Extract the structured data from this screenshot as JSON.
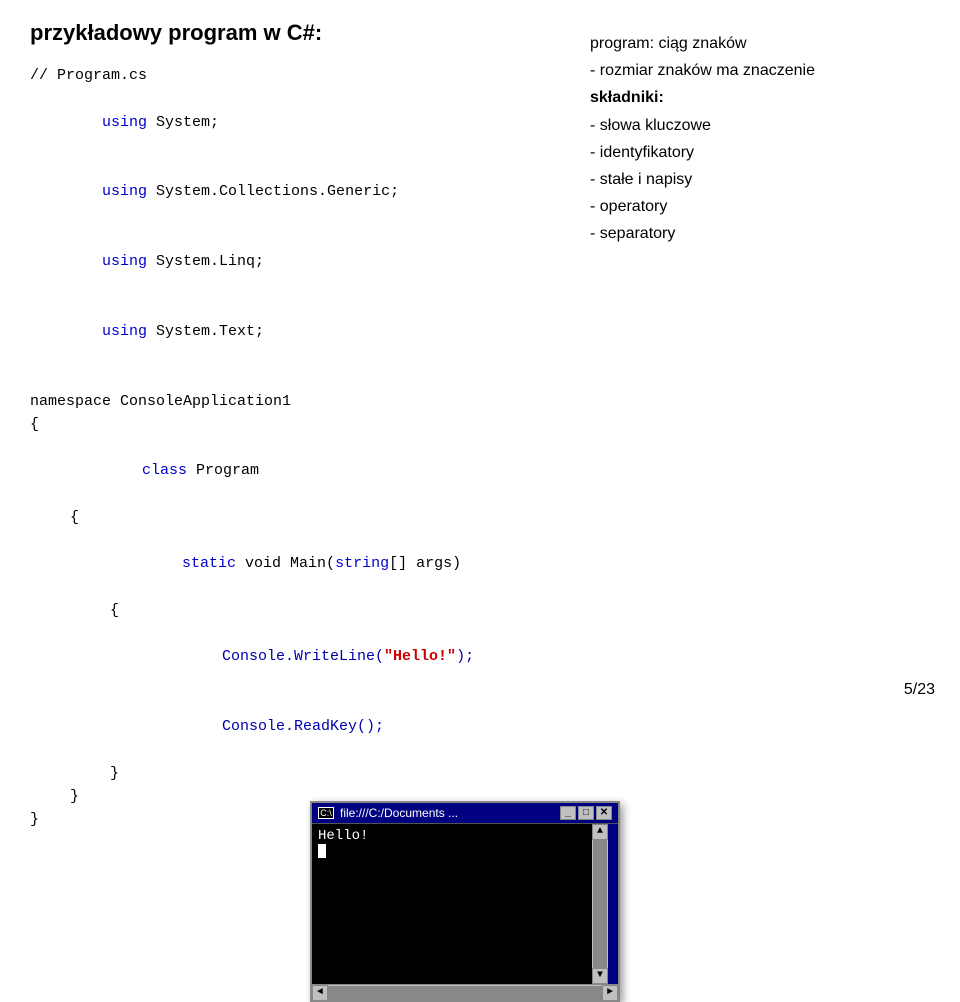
{
  "slide": {
    "title": "przykładowy program w C#:",
    "page_number": "5/23"
  },
  "code": {
    "comment_line": "// Program.cs",
    "using1": "using",
    "system1": " System;",
    "using2": "using",
    "system2": " System.Collections.Generic;",
    "using3": "using",
    "system3": " System.Linq;",
    "using4": "using",
    "system4": " System.Text;",
    "namespace_line": "namespace ConsoleApplication1",
    "brace_open1": "{",
    "class_line": "    class Program",
    "brace_open2": "    {",
    "static_line": "        static void Main(string[] args)",
    "brace_open3": "        {",
    "console_write": "            Console.",
    "writeline": "WriteLine(",
    "hello_str": "\"Hello!\"",
    "close_paren": ");",
    "console_read": "            Console.",
    "readkey": "ReadKey();",
    "brace_close1": "        }",
    "brace_close2": "    }",
    "brace_close3": "}"
  },
  "console_window": {
    "title": "file:///C:/Documents ...",
    "content_line1": "Hello!",
    "content_cursor": "_"
  },
  "description": {
    "line1": "program: ciąg znaków",
    "line2": "- rozmiar znaków ma znaczenie",
    "line3": "składniki:",
    "line4": "- słowa kluczowe",
    "line5": "- identyfikatory",
    "line6": "- stałe i napisy",
    "line7": "- operatory",
    "line8": "- separatory"
  }
}
